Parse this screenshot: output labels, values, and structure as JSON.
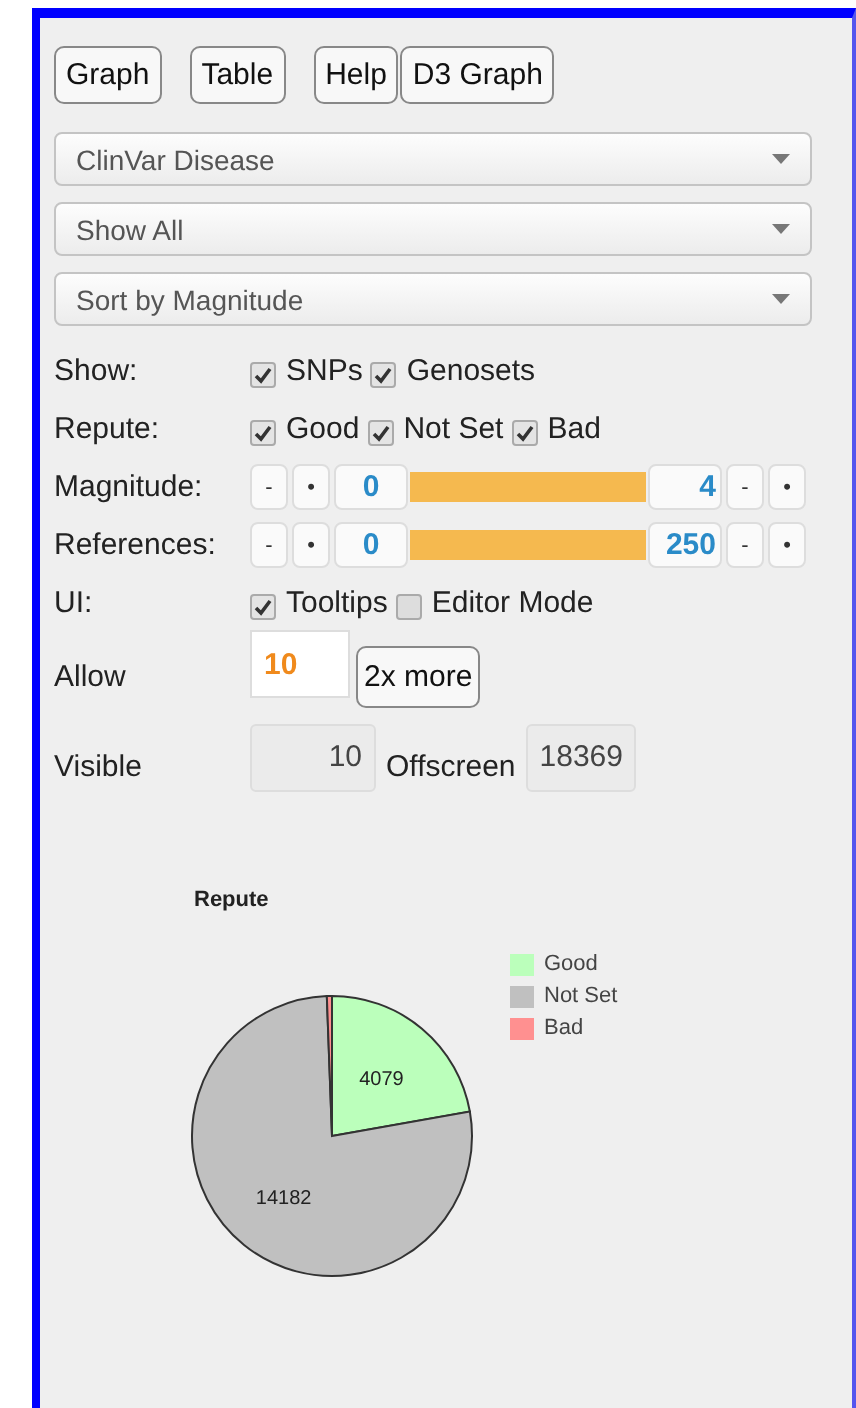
{
  "buttons": [
    {
      "label": "Graph"
    },
    {
      "label": "Table"
    },
    {
      "label": "Help"
    },
    {
      "label": "D3 Graph"
    }
  ],
  "selects": [
    {
      "value": "ClinVar Disease"
    },
    {
      "value": "Show All"
    },
    {
      "value": "Sort by Magnitude"
    }
  ],
  "filters": [
    {
      "kind": "checks",
      "label": "Show:",
      "options": [
        {
          "label": "SNPs",
          "checked": true
        },
        {
          "label": "Genosets",
          "checked": true
        }
      ]
    },
    {
      "kind": "checks",
      "label": "Repute:",
      "options": [
        {
          "label": "Good",
          "checked": true
        },
        {
          "label": "Not Set",
          "checked": true
        },
        {
          "label": "Bad",
          "checked": true
        }
      ]
    },
    {
      "kind": "range",
      "label": "Magnitude:",
      "left_buttons": [
        "-",
        "•"
      ],
      "low": "0",
      "high": "4",
      "level": 1,
      "right_buttons": [
        "-",
        "•"
      ]
    },
    {
      "kind": "range",
      "label": "References:",
      "left_buttons": [
        "-",
        "•"
      ],
      "low": "0",
      "high": "250",
      "level": 1,
      "right_buttons": [
        "-",
        "•"
      ]
    },
    {
      "kind": "checks",
      "label": "UI:",
      "options": [
        {
          "label": "Tooltips",
          "checked": true
        },
        {
          "label": "Editor Mode",
          "checked": false
        }
      ]
    }
  ],
  "allow": {
    "label": "Allow",
    "value": "10",
    "button": "2x more"
  },
  "counts": {
    "visible_label": "Visible",
    "visible": "10",
    "offscreen_label": "Offscreen",
    "offscreen": "18369"
  },
  "chart_data": {
    "type": "pie",
    "title": "Repute",
    "categories": [
      "Good",
      "Not Set",
      "Bad"
    ],
    "values": [
      4079,
      14182,
      108
    ],
    "legend": "right",
    "colors": [
      "#bbffbb",
      "#c0c0c0",
      "#ff9090"
    ],
    "value_labels": [
      "4079",
      "14182",
      null
    ]
  }
}
